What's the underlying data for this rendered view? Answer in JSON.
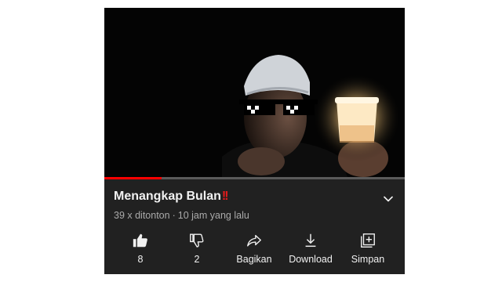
{
  "video": {
    "title": "Menangkap Bulan",
    "title_emoji": "!!",
    "views": "39 x ditonton",
    "separator": "·",
    "time_ago": "10 jam yang lalu",
    "progress_fraction": 0.19
  },
  "actions": {
    "like_count": "8",
    "dislike_count": "2",
    "share_label": "Bagikan",
    "download_label": "Download",
    "save_label": "Simpan"
  },
  "colors": {
    "background": "#212121",
    "progress": "#ff0000",
    "title_text": "#f1f1f1",
    "meta_text": "#aaaaaa"
  },
  "icons": [
    "like-icon",
    "dislike-icon",
    "share-icon",
    "download-icon",
    "save-playlist-icon",
    "chevron-down-icon"
  ]
}
